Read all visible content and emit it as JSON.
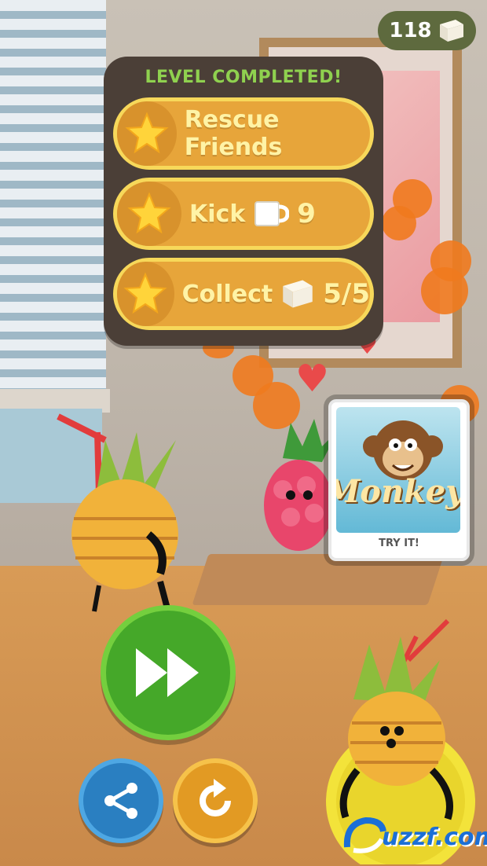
{
  "hud": {
    "coins": "118",
    "coin_icon": "sugar-cube-icon"
  },
  "panel": {
    "title": "LEVEL COMPLETED!",
    "goals": [
      {
        "label": "Rescue Friends",
        "icon": "star-icon"
      },
      {
        "label": "Kick",
        "item_icon": "cup-icon",
        "count": "9",
        "icon": "star-icon"
      },
      {
        "label": "Collect",
        "item_icon": "sugar-cube-icon",
        "count": "5/5",
        "icon": "star-icon"
      }
    ]
  },
  "ad": {
    "title": "Monkeyra",
    "cta": "TRY IT!"
  },
  "buttons": {
    "play": "fast-forward-icon",
    "share": "share-icon",
    "restart": "restart-icon"
  },
  "watermark": {
    "text": "uzzf.com"
  },
  "colors": {
    "panel_bg": "#4b3f37",
    "title_green": "#8fd14f",
    "goal_orange": "#e7a53a",
    "play_green": "#45a829",
    "share_blue": "#2a7fc1",
    "restart_orange": "#e29a23"
  }
}
